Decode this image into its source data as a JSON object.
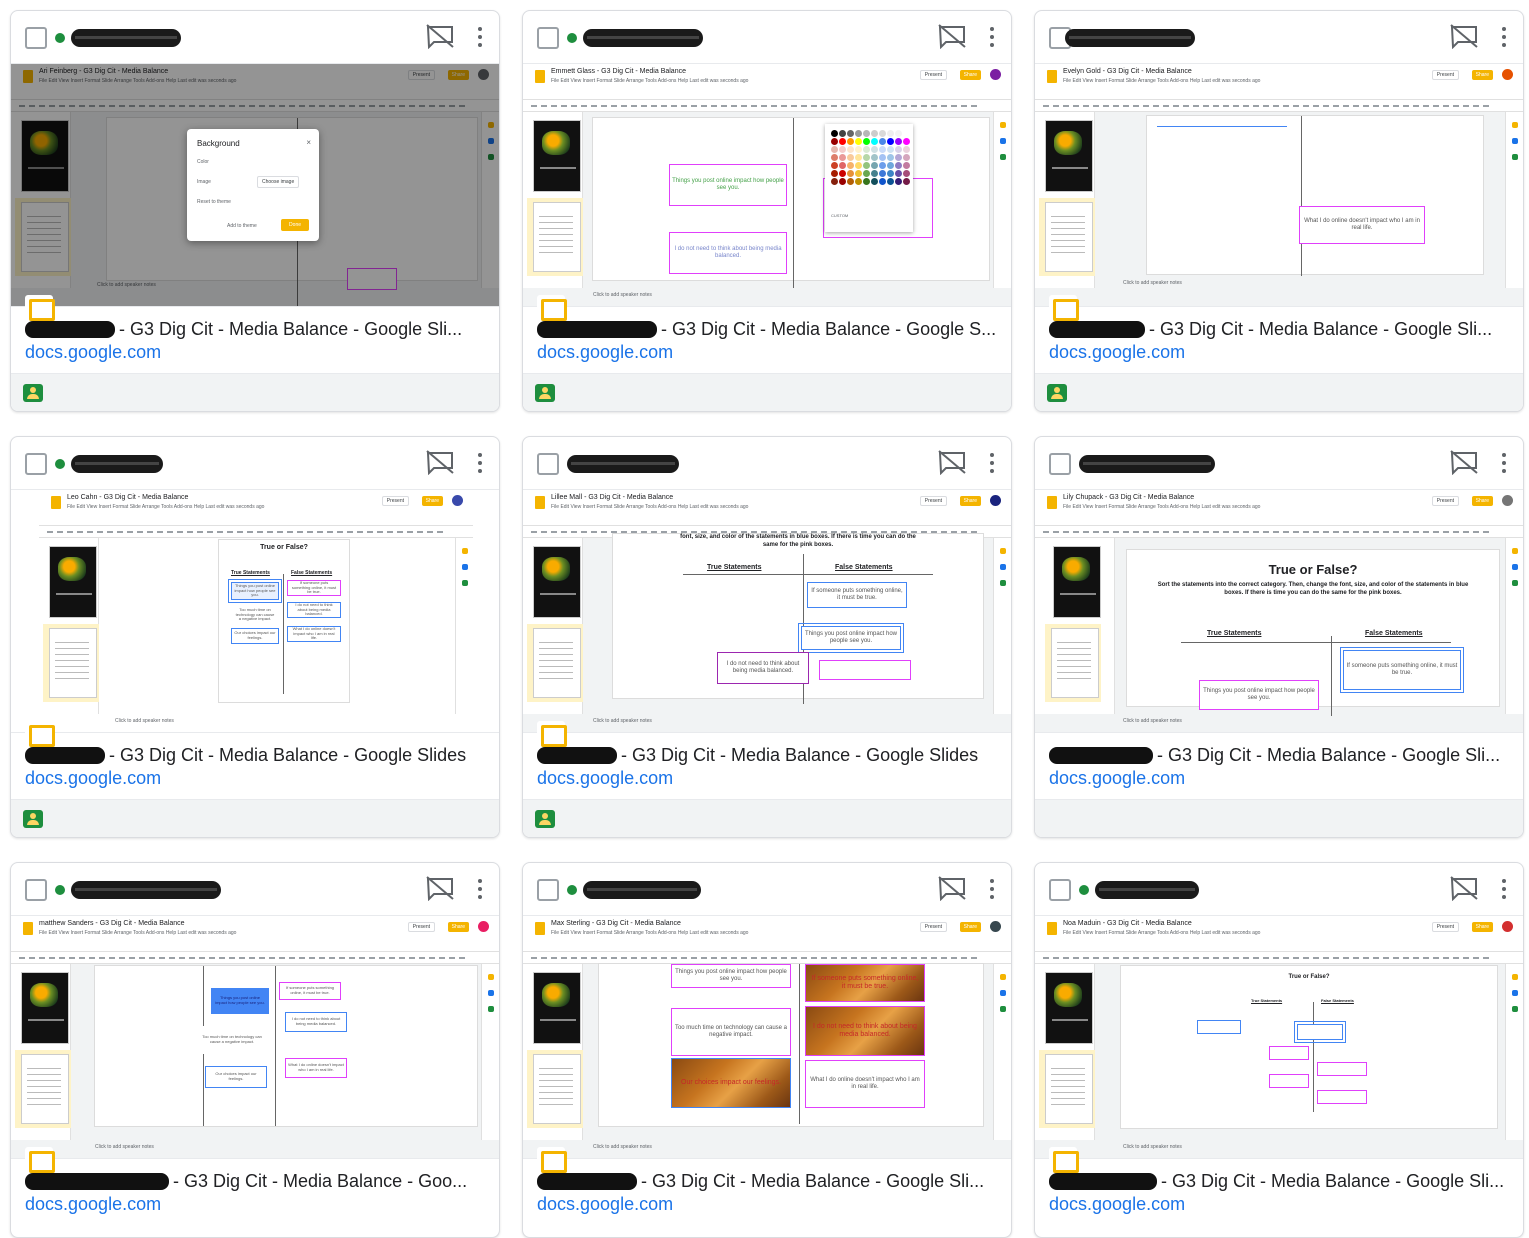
{
  "doc_title_suffix": "- G3 Dig Cit - Media Balance - Google Slides",
  "domain": "docs.google.com",
  "cards": [
    {
      "title": "- G3 Dig Cit - Media Balance - Google Sli...",
      "url": "docs.google.com",
      "doc_title": "Ari Feinberg - G3 Dig Cit - Media Balance",
      "dialog_title": "Background",
      "dialog_labels": [
        "Color",
        "Image",
        "Reset to theme"
      ],
      "dialog_choose": "Choose image",
      "dialog_add": "Add to theme",
      "dialog_done": "Done",
      "notes": "Click to add speaker notes"
    },
    {
      "title": "- G3 Dig Cit - Media Balance - Google S...",
      "url": "docs.google.com",
      "doc_title": "Emmett Glass - G3 Dig Cit - Media Balance",
      "box1": "Things you post online impact how people see you.",
      "box2": "I do not need to think about being media balanced.",
      "palette_custom": "CUSTOM",
      "notes": "Click to add speaker notes"
    },
    {
      "title": "- G3 Dig Cit - Media Balance - Google Sli...",
      "url": "docs.google.com",
      "doc_title": "Evelyn Gold - G3 Dig Cit - Media Balance",
      "box1": "What I do online doesn't impact who I am in real life.",
      "notes": "Click to add speaker notes"
    },
    {
      "title": "- G3 Dig Cit - Media Balance - Google Slides",
      "url": "docs.google.com",
      "doc_title": "Leo Cahn - G3 Dig Cit - Media Balance",
      "heading": "True or False?",
      "true_col": "True Statements",
      "false_col": "False Statements",
      "box1": "Things you post online impact how people see you.",
      "box2": "Too much time on technology can cause a negative impact.",
      "box3": "Our choices impact our feelings.",
      "box4": "If someone puts something online, it must be true.",
      "box5": "I do not need to think about being media balanced.",
      "box6": "What I do online doesn't impact who I am in real life.",
      "notes": "Click to add speaker notes"
    },
    {
      "title": "- G3 Dig Cit - Media Balance - Google Slides",
      "url": "docs.google.com",
      "doc_title": "Lillee Mall - G3 Dig Cit - Media Balance",
      "sub": "font, size, and color of the statements in blue boxes. If there is time you can do the same for the pink boxes.",
      "true_col": "True Statements",
      "false_col": "False Statements",
      "box1": "If someone puts something online, it must be true.",
      "box2": "Things you post online impact how people see you.",
      "box3": "I do not need to think about being media balanced.",
      "notes": "Click to add speaker notes"
    },
    {
      "title": "- G3 Dig Cit - Media Balance - Google Sli...",
      "url": "docs.google.com",
      "doc_title": "Lily Chupack - G3 Dig Cit - Media Balance",
      "heading": "True or False?",
      "sub": "Sort the statements into the correct category. Then, change the font, size, and color of the statements in blue boxes. If there is time you can do the same for the pink boxes.",
      "true_col": "True Statements",
      "false_col": "False Statements",
      "box1": "If someone puts something online, it must be true.",
      "box2": "Things you post online impact how people see you.",
      "notes": "Click to add speaker notes"
    },
    {
      "title": "- G3 Dig Cit - Media Balance - Goo...",
      "url": "docs.google.com",
      "doc_title": "matthew Sanders - G3 Dig Cit - Media Balance",
      "box1": "Things you post online impact how people see you.",
      "box2": "Too much time on technology can cause a negative impact.",
      "box3": "Our choices impact our feelings.",
      "box4": "If someone puts something online, it must be true.",
      "box5": "I do not need to think about being media balanced.",
      "box6": "What I do online doesn't impact who I am in real life.",
      "notes": "Click to add speaker notes"
    },
    {
      "title": "- G3 Dig Cit - Media Balance - Google Sli...",
      "url": "docs.google.com",
      "doc_title": "Max Sterling - G3 Dig Cit - Media Balance",
      "box1": "Things you post online impact how people see you.",
      "box2": "Too much time on technology can cause a negative impact.",
      "box3": "Our choices impact our feelings.",
      "box4": "If someone puts something online, it must be true.",
      "box5": "I do not need to think about being media balanced.",
      "box6": "What I do online doesn't impact who I am in real life.",
      "notes": "Click to add speaker notes"
    },
    {
      "title": "- G3 Dig Cit - Media Balance - Google Sli...",
      "url": "docs.google.com",
      "doc_title": "Noa Maduin - G3 Dig Cit - Media Balance",
      "heading": "True or False?",
      "true_col": "True Statements",
      "false_col": "False Statements",
      "notes": "Click to add speaker notes"
    }
  ],
  "slides_menu": "File  Edit  View  Insert  Format  Slide  Arrange  Tools  Add-ons  Help   Last edit was seconds ago",
  "present_label": "Present",
  "share_label": "Share",
  "colors": {
    "accent": "#1a73e8",
    "slides_yellow": "#f4b400",
    "classroom_green": "#1e8e3e",
    "online_green": "#1e8e3e"
  },
  "icons": [
    "checkbox-icon",
    "presence-off-icon",
    "more-vert-icon",
    "slides-icon",
    "classroom-icon"
  ]
}
